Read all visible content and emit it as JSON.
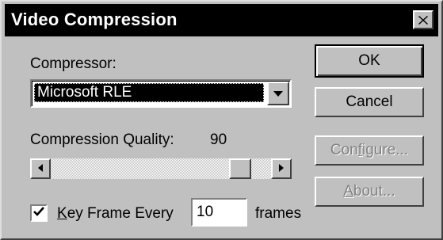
{
  "window": {
    "title": "Video Compression",
    "close_icon": "close-icon"
  },
  "compressor": {
    "label": "Compressor:",
    "selected": "Microsoft RLE",
    "arrow_icon": "chevron-down-icon"
  },
  "quality": {
    "label": "Compression Quality:",
    "value": "90",
    "slider_fraction": 0.9
  },
  "keyframe": {
    "checked": true,
    "label": "Key Frame Every",
    "value": "10",
    "suffix": "frames"
  },
  "buttons": {
    "ok": "OK",
    "cancel": "Cancel",
    "configure": "Configure...",
    "about": "About..."
  },
  "colors": {
    "titlebar": "#000000",
    "face": "#c0c0c0",
    "selection": "#000000"
  }
}
